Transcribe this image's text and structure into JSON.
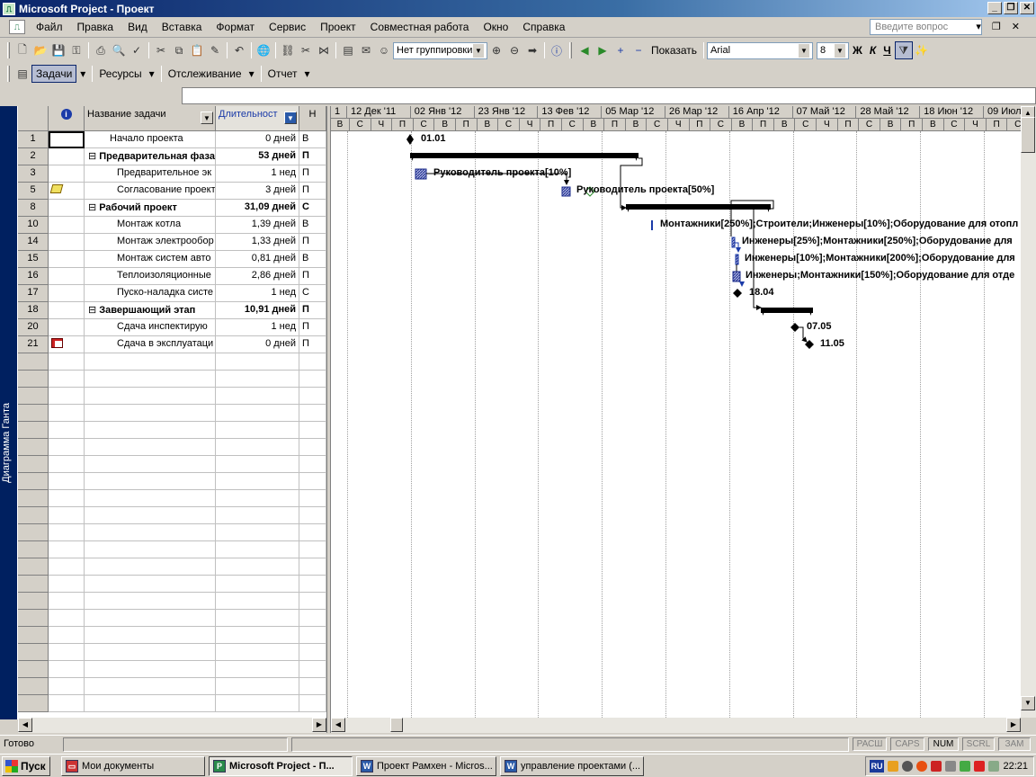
{
  "window": {
    "title": "Microsoft Project - Проект"
  },
  "menu": {
    "items": [
      "Файл",
      "Правка",
      "Вид",
      "Вставка",
      "Формат",
      "Сервис",
      "Проект",
      "Совместная работа",
      "Окно",
      "Справка"
    ],
    "help_placeholder": "Введите вопрос"
  },
  "toolbar": {
    "group_by": "Нет группировки",
    "show_label": "Показать",
    "font": "Arial",
    "font_size": "8",
    "bold": "Ж",
    "italic": "К",
    "underline": "Ч"
  },
  "toolbar2": {
    "tasks": "Задачи",
    "resources": "Ресурсы",
    "tracking": "Отслеживание",
    "report": "Отчет"
  },
  "view_bar": {
    "label": "Диаграмма Ганта"
  },
  "columns": {
    "info": "i",
    "name": "Название задачи",
    "duration": "Длительност",
    "start": "Н"
  },
  "rows": [
    {
      "id": "1",
      "indicator": "",
      "name": "Начало проекта",
      "duration": "0 дней",
      "start": "В",
      "summary": false
    },
    {
      "id": "2",
      "indicator": "",
      "name": "Предварительная фаза",
      "duration": "53 дней",
      "start": "П",
      "summary": true
    },
    {
      "id": "3",
      "indicator": "",
      "name": "Предварительное эк",
      "duration": "1 нед",
      "start": "П",
      "summary": false
    },
    {
      "id": "5",
      "indicator": "note",
      "name": "Согласование проект",
      "duration": "3 дней",
      "start": "П",
      "summary": false
    },
    {
      "id": "8",
      "indicator": "",
      "name": "Рабочий проект",
      "duration": "31,09 дней",
      "start": "С",
      "summary": true
    },
    {
      "id": "10",
      "indicator": "",
      "name": "Монтаж котла",
      "duration": "1,39 дней",
      "start": "В",
      "summary": false
    },
    {
      "id": "14",
      "indicator": "",
      "name": "Монтаж электрообор",
      "duration": "1,33 дней",
      "start": "П",
      "summary": false
    },
    {
      "id": "15",
      "indicator": "",
      "name": "Монтаж систем авто",
      "duration": "0,81 дней",
      "start": "В",
      "summary": false
    },
    {
      "id": "16",
      "indicator": "",
      "name": "Теплоизоляционные",
      "duration": "2,86 дней",
      "start": "П",
      "summary": false
    },
    {
      "id": "17",
      "indicator": "",
      "name": "Пуско-наладка систе",
      "duration": "1 нед",
      "start": "С",
      "summary": false
    },
    {
      "id": "18",
      "indicator": "",
      "name": "Завершающий этап",
      "duration": "10,91 дней",
      "start": "П",
      "summary": true
    },
    {
      "id": "20",
      "indicator": "",
      "name": "Сдача инспектирую",
      "duration": "1 нед",
      "start": "П",
      "summary": false
    },
    {
      "id": "21",
      "indicator": "calendar",
      "name": "Сдача в эксплуатаци",
      "duration": "0 дней",
      "start": "П",
      "summary": false
    }
  ],
  "timescale": {
    "weeks": [
      "1",
      "12 Дек '11",
      "02 Янв '12",
      "23 Янв '12",
      "13 Фев '12",
      "05 Мар '12",
      "26 Мар '12",
      "16 Апр '12",
      "07 Май '12",
      "28 Май '12",
      "18 Июн '12",
      "09 Июл"
    ],
    "days": [
      "В",
      "С",
      "Ч",
      "П",
      "С",
      "В",
      "П",
      "В",
      "С",
      "Ч",
      "П",
      "С",
      "В",
      "П",
      "В",
      "С",
      "Ч",
      "П",
      "С",
      "В",
      "П",
      "В",
      "С",
      "Ч",
      "П",
      "С",
      "В",
      "П",
      "В",
      "С",
      "Ч",
      "П",
      "С",
      "В",
      "П",
      "В",
      "С",
      "Ч",
      "П"
    ]
  },
  "gantt_labels": {
    "m1": "01.01",
    "r3": "Руководитель проекта[10%]",
    "r5": "Руководитель проекта[50%]",
    "r10": "Монтажники[250%];Строители;Инженеры[10%];Оборудование для отопл",
    "r14": "Инженеры[25%];Монтажники[250%];Оборудование для",
    "r15": "Инженеры[10%];Монтажники[200%];Оборудование для",
    "r16": "Инженеры;Монтажники[150%];Оборудование для отде",
    "m17": "18.04",
    "m20": "07.05",
    "m21": "11.05"
  },
  "status": {
    "ready": "Готово",
    "indicators": [
      "РАСШ",
      "CAPS",
      "NUM",
      "SCRL",
      "ЗАМ"
    ]
  },
  "taskbar": {
    "start": "Пуск",
    "tasks": [
      "Мои документы",
      "Microsoft Project - П...",
      "Проект Рамхен - Micros...",
      "управление проектами (..."
    ],
    "lang": "RU",
    "clock": "22:21"
  }
}
